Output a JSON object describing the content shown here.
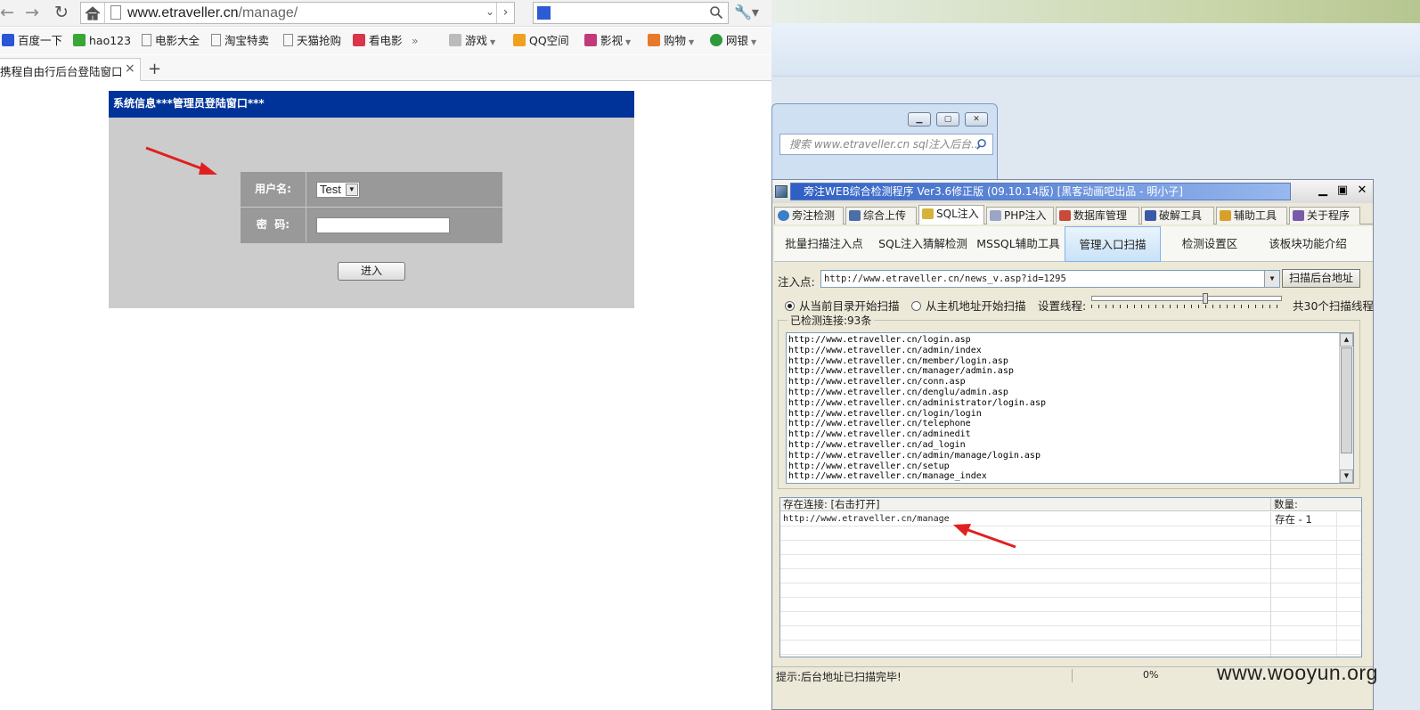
{
  "browser": {
    "url_host": "www.etraveller.cn",
    "url_path": "/manage/",
    "bookmarks": [
      {
        "label": "百度一下",
        "color": "#2a55d6"
      },
      {
        "label": "hao123",
        "color": "#3aa635"
      },
      {
        "label": "电影大全",
        "color": "#cccccc"
      },
      {
        "label": "淘宝特卖",
        "color": "#cccccc"
      },
      {
        "label": "天猫抢购",
        "color": "#cccccc"
      },
      {
        "label": "看电影",
        "color": "#d9354b"
      },
      {
        "label": "»",
        "color": ""
      },
      {
        "label": "游戏",
        "color": "#888888"
      },
      {
        "label": "QQ空间",
        "color": "#f0a020"
      },
      {
        "label": "影视",
        "color": "#c23a7a"
      },
      {
        "label": "购物",
        "color": "#e8782a"
      },
      {
        "label": "网银",
        "color": "#2f9a3a"
      }
    ],
    "tab_title": "携程自由行后台登陆窗口",
    "tab_close": "×",
    "new_tab": "+",
    "icons": {
      "back": "←",
      "forward": "→",
      "reload": "↻",
      "home": "home-icon",
      "search": "search-icon",
      "wrench": "wrench-icon"
    }
  },
  "login": {
    "header": "系统信息***管理员登陆窗口***",
    "username_label": "用户名:",
    "username_value": "Test",
    "password_label": "密  码:",
    "submit_label": "进入",
    "header_color": "#003399"
  },
  "ie_window": {
    "search_placeholder": "搜索 www.etraveller.cn sql注入后台..."
  },
  "tool": {
    "title": "旁注WEB综合检测程序 Ver3.6修正版 (09.10.14版) [黑客动画吧出品 - 明小子]",
    "tabs": [
      {
        "label": "旁注检测",
        "color": "#3a7dc8"
      },
      {
        "label": "综合上传",
        "color": "#4a6ea8"
      },
      {
        "label": "SQL注入",
        "color": "#d6b23a"
      },
      {
        "label": "PHP注入",
        "color": "#9aa6c8"
      },
      {
        "label": "数据库管理",
        "color": "#c84a3a"
      },
      {
        "label": "破解工具",
        "color": "#3a5aa8"
      },
      {
        "label": "辅助工具",
        "color": "#d8a02a"
      },
      {
        "label": "关于程序",
        "color": "#7a5aa8"
      }
    ],
    "subtabs": [
      "批量扫描注入点",
      "SQL注入猜解检测",
      "MSSQL辅助工具",
      "管理入口扫描",
      "检测设置区",
      "该板块功能介绍"
    ],
    "inject_label": "注入点:",
    "inject_url": "http://www.etraveller.cn/news_v.asp?id=1295",
    "scan_button": "扫描后台地址",
    "radio_current": "从当前目录开始扫描",
    "radio_host": "从主机地址开始扫描",
    "thread_label": "设置线程:",
    "thread_count": "共30个扫描线程",
    "thread_level": 0.6,
    "detected_label": "已检测连接:93条",
    "detected_links": [
      "http://www.etraveller.cn/login.asp",
      "http://www.etraveller.cn/admin/index",
      "http://www.etraveller.cn/member/login.asp",
      "http://www.etraveller.cn/manager/admin.asp",
      "http://www.etraveller.cn/conn.asp",
      "http://www.etraveller.cn/denglu/admin.asp",
      "http://www.etraveller.cn/administrator/login.asp",
      "http://www.etraveller.cn/login/login",
      "http://www.etraveller.cn/telephone",
      "http://www.etraveller.cn/adminedit",
      "http://www.etraveller.cn/ad_login",
      "http://www.etraveller.cn/admin/manage/login.asp",
      "http://www.etraveller.cn/setup",
      "http://www.etraveller.cn/manage_index"
    ],
    "results_col_link": "存在连接: [右击打开]",
    "results_col_count": "数量:",
    "result_link": "http://www.etraveller.cn/manage",
    "result_count": "存在 - 1",
    "status_text": "提示:后台地址已扫描完毕!",
    "status_progress": "0%"
  },
  "watermark": "www.wooyun.org",
  "colors": {
    "arrow": "#e02020"
  }
}
